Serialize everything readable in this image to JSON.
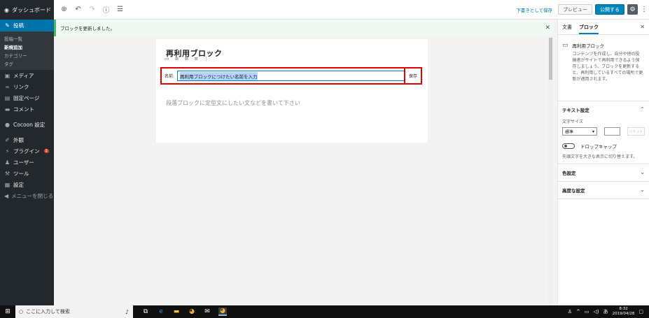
{
  "wp_sidebar": {
    "brand": "ダッシュボード",
    "posts_label": "投稿",
    "submenu": [
      "投稿一覧",
      "新規追加",
      "カテゴリー",
      "タグ"
    ],
    "menu": [
      "メディア",
      "リンク",
      "固定ページ",
      "コメント"
    ],
    "cocoon": "Cocoon 設定",
    "menu2": [
      "外観",
      "プラグイン",
      "ユーザー",
      "ツール",
      "設定"
    ],
    "plugin_badge": "1",
    "collapse": "メニューを閉じる"
  },
  "header": {
    "save_draft": "下書きとして保存",
    "preview": "プレビュー",
    "publish": "公開する"
  },
  "notice": {
    "text": "ブロックを更新しました。"
  },
  "editor": {
    "block_title": "再利用ブロック",
    "name_label": "名前:",
    "name_value": "再利用ブロックにつけたい名前を入力",
    "save_button": "保存",
    "paragraph_placeholder": "段落ブロックに定型文にしたい文などを書いて下さい"
  },
  "settings": {
    "tab_document": "文書",
    "tab_block": "ブロック",
    "block_name": "再利用ブロック",
    "block_desc": "コンテンツを作成し、自分や他の投稿者がサイトで再利用できるよう保存しましょう。ブロックを更新すると、再利用しているすべての場所で更新が適用されます。",
    "text_settings": "テキスト設定",
    "font_size_label": "文字サイズ",
    "font_size_value": "標準",
    "reset": "リセット",
    "drop_cap": "ドロップキャップ",
    "drop_cap_help": "先頭文字を大きな表示に切り替えます。",
    "color_settings": "色設定",
    "advanced": "高度な設定"
  },
  "taskbar": {
    "search_placeholder": "ここに入力して検索",
    "ime": "あ",
    "time": "8:32",
    "date": "2019/04/28"
  }
}
